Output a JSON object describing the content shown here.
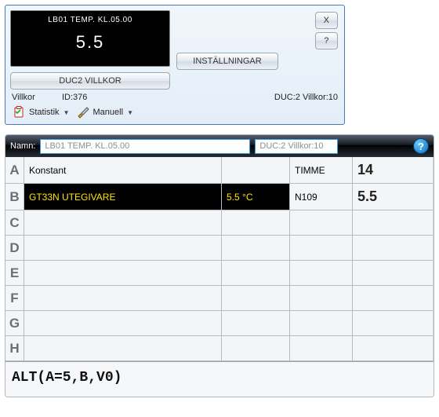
{
  "top": {
    "lcd_title": "LB01 TEMP. KL.05.00",
    "lcd_value": "5.5",
    "close_label": "X",
    "help_label": "?",
    "settings_label": "INSTÄLLNINGAR",
    "main_button_label": "DUC2 VILLKOR",
    "villkor_label": "Villkor",
    "id_label": "ID:376",
    "duc_label": "DUC:2 Villkor:10",
    "statistics_label": "Statistik",
    "manual_label": "Manuell"
  },
  "bottom": {
    "name_label": "Namn:",
    "name_value": "LB01 TEMP. KL.05.00",
    "duc_value": "DUC:2 Villkor:10",
    "help_glyph": "?",
    "rows": {
      "A": {
        "letter": "A",
        "name": "Konstant",
        "val2": "",
        "val3": "TIMME",
        "val4": "14"
      },
      "B": {
        "letter": "B",
        "name": "GT33N UTEGIVARE",
        "val2": "5.5 °C",
        "val3": "N109",
        "val4": "5.5"
      },
      "C": {
        "letter": "C",
        "name": "",
        "val2": "",
        "val3": "",
        "val4": ""
      },
      "D": {
        "letter": "D",
        "name": "",
        "val2": "",
        "val3": "",
        "val4": ""
      },
      "E": {
        "letter": "E",
        "name": "",
        "val2": "",
        "val3": "",
        "val4": ""
      },
      "F": {
        "letter": "F",
        "name": "",
        "val2": "",
        "val3": "",
        "val4": ""
      },
      "G": {
        "letter": "G",
        "name": "",
        "val2": "",
        "val3": "",
        "val4": ""
      },
      "H": {
        "letter": "H",
        "name": "",
        "val2": "",
        "val3": "",
        "val4": ""
      }
    },
    "formula": "ALT(A=5,B,V0)"
  }
}
